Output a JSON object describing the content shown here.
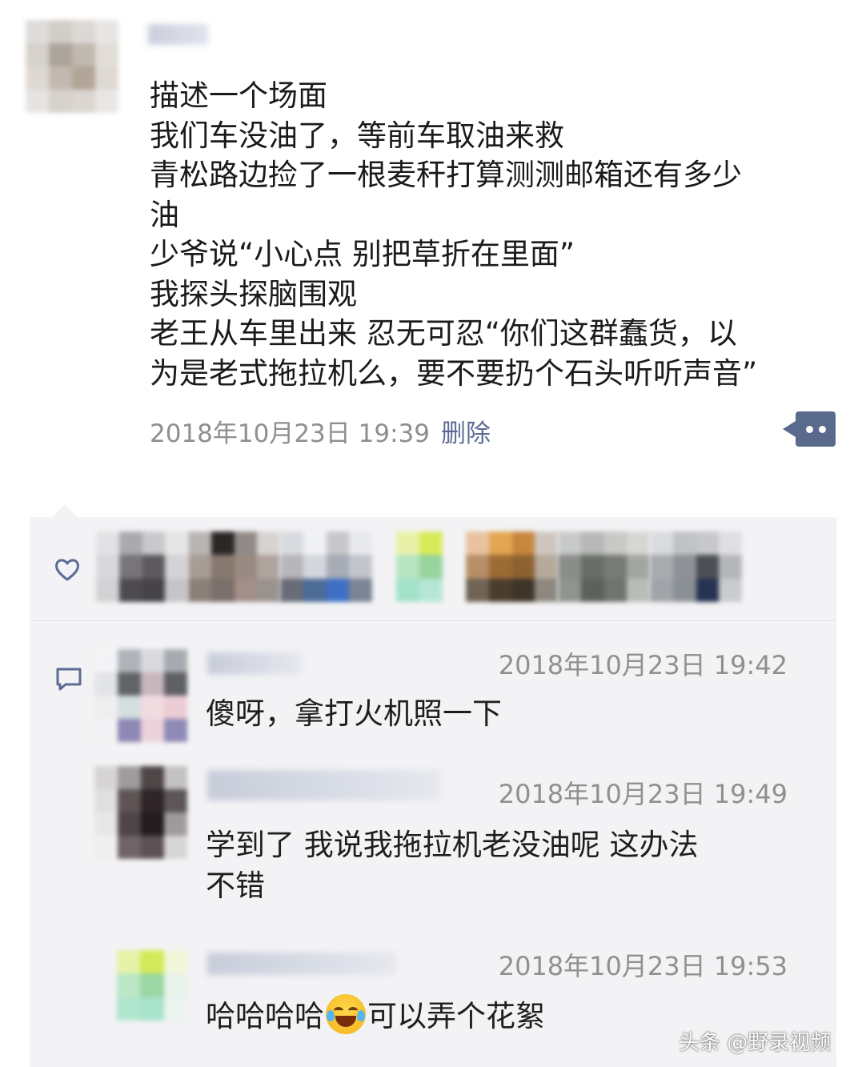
{
  "post": {
    "lines": [
      "描述一个场面",
      "我们车没油了，等前车取油来救",
      "青松路边捡了一根麦秆打算测测邮箱还有多少",
      "油",
      "少爷说“小心点 别把草折在里面”",
      "我探头探脑围观",
      "老王从车里出来 忍无可忍“你们这群蠢货，以",
      "为是老式拖拉机么，要不要扔个石头听听声音”"
    ],
    "timestamp": "2018年10月23日 19:39",
    "delete_label": "删除"
  },
  "comments": [
    {
      "time": "2018年10月23日 19:42",
      "lines": [
        "傻呀，拿打火机照一下"
      ]
    },
    {
      "time": "2018年10月23日 19:49",
      "lines": [
        "学到了 我说我拖拉机老没油呢 这办法",
        "不错"
      ]
    },
    {
      "time": "2018年10月23日 19:53",
      "text_before": "哈哈哈哈",
      "emoji": "tears-of-joy-emoji",
      "text_after": "可以弄个花絮"
    }
  ],
  "icons": {
    "like": "heart-outline-icon",
    "comment": "speech-bubble-icon",
    "more": "more-dots-icon"
  },
  "watermark": "头条 @野录视频",
  "colors": {
    "link_blue": "#5b6b95",
    "more_button": "#596a8d",
    "comment_bg": "#f3f3f5",
    "timestamp_gray": "#8e8e8e"
  }
}
